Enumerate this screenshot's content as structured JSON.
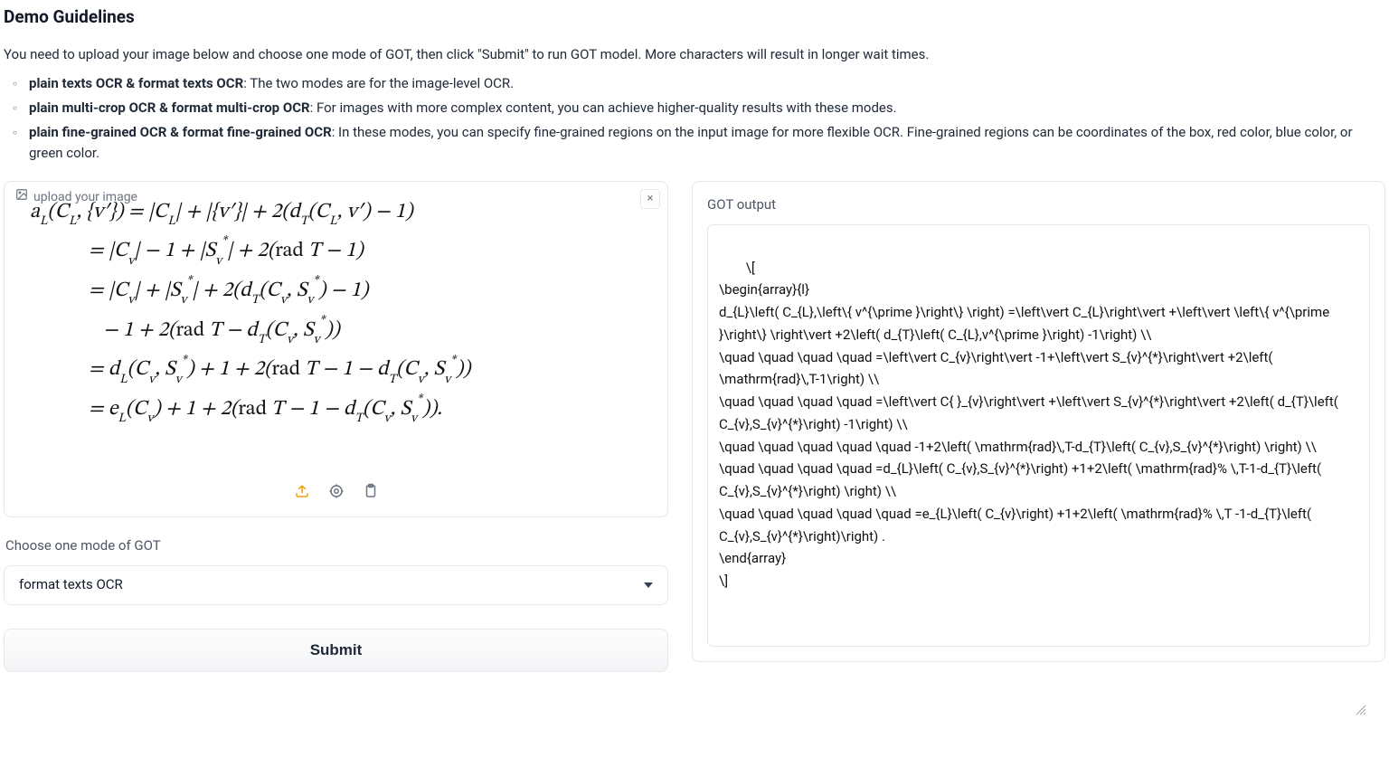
{
  "title": "Demo Guidelines",
  "intro": "You need to upload your image below and choose one mode of GOT, then click \"Submit\" to run GOT model. More characters will result in longer wait times.",
  "modes": [
    {
      "bold": "plain texts OCR & format texts OCR",
      "rest": ": The two modes are for the image-level OCR."
    },
    {
      "bold": "plain multi-crop OCR & format multi-crop OCR",
      "rest": ": For images with more complex content, you can achieve higher-quality results with these modes."
    },
    {
      "bold": "plain fine-grained OCR & format fine-grained OCR",
      "rest": ": In these modes, you can specify fine-grained regions on the input image for more flexible OCR. Fine-grained regions can be coordinates of the box, red color, blue color, or green color."
    }
  ],
  "upload": {
    "label": "upload your image",
    "close": "×"
  },
  "math_rows": [
    "a<sub>L</sub>(C<sub>L</sub>, {v′}) = |C<sub>L</sub>| + |{v′}| + 2(d<sub>T</sub>(C<sub>L</sub>, v′) − 1)",
    "&nbsp;&nbsp;&nbsp;&nbsp;&nbsp;&nbsp;&nbsp;&nbsp;&nbsp;&nbsp;&nbsp;&nbsp;= |C<sub>v</sub>| − 1 + |S<sub>v</sub><sup>*</sup>| + 2(<span class='up'>rad</span> T − 1)",
    "&nbsp;&nbsp;&nbsp;&nbsp;&nbsp;&nbsp;&nbsp;&nbsp;&nbsp;&nbsp;&nbsp;&nbsp;= |C<sub>v</sub>| + |S<sub>v</sub><sup>*</sup>| + 2(d<sub>T</sub>(C<sub>v</sub>, S<sub>v</sub><sup>*</sup>) − 1)",
    "&nbsp;&nbsp;&nbsp;&nbsp;&nbsp;&nbsp;&nbsp;&nbsp;&nbsp;&nbsp;&nbsp;&nbsp;&nbsp;&nbsp;&nbsp;− 1 + 2(<span class='up'>rad</span> T − d<sub>T</sub>(C<sub>v</sub>, S<sub>v</sub><sup>*</sup>))",
    "&nbsp;&nbsp;&nbsp;&nbsp;&nbsp;&nbsp;&nbsp;&nbsp;&nbsp;&nbsp;&nbsp;&nbsp;= d<sub>L</sub>(C<sub>v</sub>, S<sub>v</sub><sup>*</sup>) + 1 + 2(<span class='up'>rad</span> T − 1 − d<sub>T</sub>(C<sub>v</sub>, S<sub>v</sub><sup>*</sup>))",
    "&nbsp;&nbsp;&nbsp;&nbsp;&nbsp;&nbsp;&nbsp;&nbsp;&nbsp;&nbsp;&nbsp;&nbsp;= e<sub>L</sub>(C<sub>v</sub>) + 1 + 2(<span class='up'>rad</span> T − 1 − d<sub>T</sub>(C<sub>v</sub>, S<sub>v</sub><sup>*</sup>))."
  ],
  "mode_label": "Choose one mode of GOT",
  "selected_mode": "format texts OCR",
  "submit_label": "Submit",
  "output": {
    "title": "GOT output",
    "text": "\\[\n\\begin{array}{l}\nd_{L}\\left( C_{L},\\left\\{ v^{\\prime }\\right\\} \\right) =\\left\\vert C_{L}\\right\\vert +\\left\\vert \\left\\{ v^{\\prime }\\right\\} \\right\\vert +2\\left( d_{T}\\left( C_{L},v^{\\prime }\\right) -1\\right) \\\\\n\\quad \\quad \\quad \\quad =\\left\\vert C_{v}\\right\\vert -1+\\left\\vert S_{v}^{*}\\right\\vert +2\\left( \\mathrm{rad}\\,T-1\\right) \\\\\n\\quad \\quad \\quad \\quad =\\left\\vert C{ }_{v}\\right\\vert +\\left\\vert S_{v}^{*}\\right\\vert +2\\left( d_{T}\\left( C_{v},S_{v}^{*}\\right) -1\\right) \\\\\n\\quad \\quad \\quad \\quad \\quad -1+2\\left( \\mathrm{rad}\\,T-d_{T}\\left( C_{v},S_{v}^{*}\\right) \\right) \\\\\n\\quad \\quad \\quad \\quad =d_{L}\\left( C_{v},S_{v}^{*}\\right) +1+2\\left( \\mathrm{rad}% \\,T-1-d_{T}\\left( C_{v},S_{v}^{*}\\right) \\right) \\\\\n\\quad \\quad \\quad \\quad \\quad =e_{L}\\left( C_{v}\\right) +1+2\\left( \\mathrm{rad}% \\,T -1-d_{T}\\left( C_{v},S_{v}^{*}\\right)\\right) .\n\\end{array}\n\\]"
  }
}
